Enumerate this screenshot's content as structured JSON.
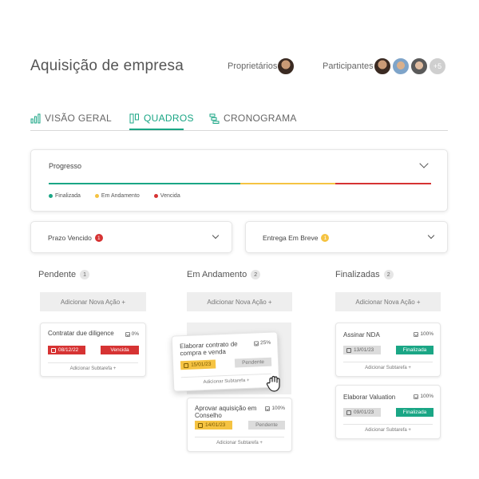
{
  "header": {
    "title": "Aquisição de empresa",
    "owners_label": "Proprietários:",
    "participants_label": "Participantes:",
    "participants_more": "+5"
  },
  "tabs": [
    {
      "label": "VISÃO GERAL",
      "icon": "bar-chart-icon"
    },
    {
      "label": "QUADROS",
      "icon": "board-icon",
      "active": true
    },
    {
      "label": "CRONOGRAMA",
      "icon": "timeline-icon"
    }
  ],
  "progress": {
    "title": "Progresso",
    "segments": [
      {
        "status": "Finalizada",
        "fraction": 0.5,
        "color": "#1aa685"
      },
      {
        "status": "Em Andamento",
        "fraction": 0.25,
        "color": "#f5c342"
      },
      {
        "status": "Vencida",
        "fraction": 0.25,
        "color": "#d63333"
      }
    ],
    "legend": [
      "Finalizada",
      "Em Andamento",
      "Vencida"
    ]
  },
  "filters": {
    "overdue": {
      "label": "Prazo Vencido",
      "count": "1",
      "color": "#d63333"
    },
    "due_soon": {
      "label": "Entrega Em Breve",
      "count": "1",
      "color": "#f5c342"
    }
  },
  "columns": [
    {
      "title": "Pendente",
      "count": "1",
      "add_label": "Adicionar Nova Ação +"
    },
    {
      "title": "Em Andamento",
      "count": "2",
      "add_label": "Adicionar Nova Ação +"
    },
    {
      "title": "Finalizadas",
      "count": "2",
      "add_label": "Adicionar Nova Ação +"
    }
  ],
  "tasks": {
    "due_diligence": {
      "title": "Contratar due diligence",
      "pct": "0%",
      "date": "08/12/22",
      "status": "Vencida",
      "subtask": "Adicionar Subtarefa +"
    },
    "contrato": {
      "title": "Elaborar contrato de compra e venda",
      "pct": "25%",
      "date": "15/01/23",
      "status": "Pendente",
      "subtask": "Adicionar Subtarefa +"
    },
    "aprovar": {
      "title": "Aprovar aquisição em Conselho",
      "pct": "100%",
      "date": "14/01/23",
      "status": "Pendente",
      "subtask": "Adicionar Subtarefa +"
    },
    "nda": {
      "title": "Assinar NDA",
      "pct": "100%",
      "date": "13/01/23",
      "status": "Finalizada",
      "subtask": "Adicionar Subtarefa +"
    },
    "valuation": {
      "title": "Elaborar Valuation",
      "pct": "100%",
      "date": "09/01/23",
      "status": "Finalizada",
      "subtask": "Adicionar Subtarefa +"
    }
  },
  "colors": {
    "accent": "#1aa685",
    "warning": "#f5c342",
    "danger": "#d63333"
  }
}
